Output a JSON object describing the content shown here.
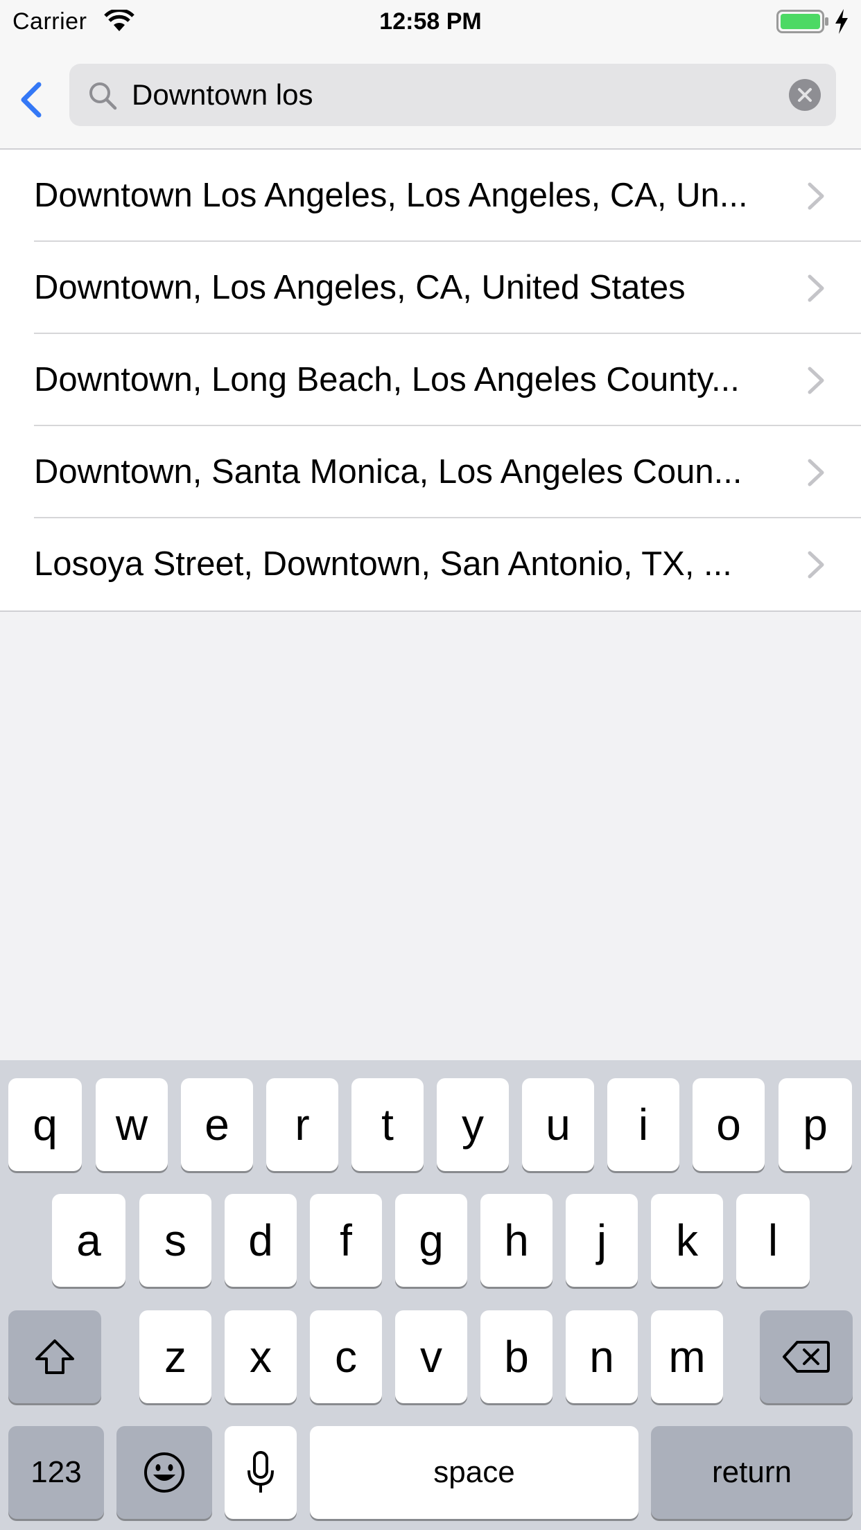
{
  "status_bar": {
    "carrier": "Carrier",
    "time": "12:58 PM",
    "wifi_icon": "wifi-icon",
    "battery_icon": "battery-charging-icon",
    "battery_color": "#4cd964"
  },
  "nav": {
    "back_icon": "chevron-left-icon",
    "accent_color": "#3478f6",
    "search": {
      "value": "Downtown los",
      "icon": "search-icon",
      "clear_icon": "clear-circle-icon"
    }
  },
  "results": [
    {
      "label": "Downtown Los Angeles, Los Angeles, CA, Un..."
    },
    {
      "label": "Downtown, Los Angeles, CA, United States"
    },
    {
      "label": "Downtown, Long Beach, Los Angeles County..."
    },
    {
      "label": "Downtown, Santa Monica, Los Angeles Coun..."
    },
    {
      "label": "Losoya Street, Downtown, San Antonio, TX, ..."
    }
  ],
  "keyboard": {
    "row1": [
      "q",
      "w",
      "e",
      "r",
      "t",
      "y",
      "u",
      "i",
      "o",
      "p"
    ],
    "row2": [
      "a",
      "s",
      "d",
      "f",
      "g",
      "h",
      "j",
      "k",
      "l"
    ],
    "row3": [
      "z",
      "x",
      "c",
      "v",
      "b",
      "n",
      "m"
    ],
    "numbers_label": "123",
    "space_label": "space",
    "return_label": "return",
    "shift_icon": "shift-icon",
    "delete_icon": "delete-icon",
    "emoji_icon": "emoji-icon",
    "mic_icon": "microphone-icon"
  }
}
